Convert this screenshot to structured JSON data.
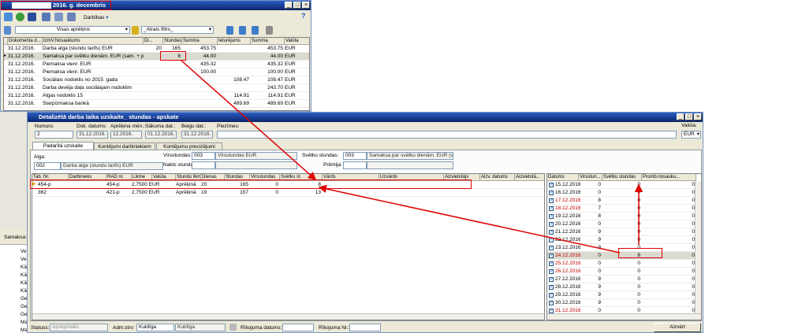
{
  "top_window": {
    "title": "2016. g. decembris",
    "toolbar_darbibas": "Darbības",
    "filter_value": "Visas aprēķins",
    "quick_filter": "_Ātrais filtrs_",
    "columns": [
      "Dokumenta d...",
      "IzmV.Nosaukums",
      "Di...",
      "Stundas",
      "Summa",
      "Ieturējums",
      "Summa",
      "Valūta"
    ],
    "rows": [
      {
        "date": "31.12.2016.",
        "name": "Darba alga (stundu tarifs) EUR",
        "di": "20",
        "hours": "165",
        "sum": "453.75",
        "ded": "",
        "total": "453.75",
        "cur": "EUR"
      },
      {
        "date": "31.12.2016.",
        "name": "Samaksa par svētku dienām. EUR (sam. + piem.)",
        "di": "",
        "hours": "8",
        "sum": "44.00",
        "ded": "",
        "total": "44.00",
        "cur": "EUR"
      },
      {
        "date": "31.12.2016.",
        "name": "Piemaksa vienr. EUR",
        "di": "",
        "hours": "",
        "sum": "435.32",
        "ded": "",
        "total": "435.32",
        "cur": "EUR"
      },
      {
        "date": "31.12.2016.",
        "name": "Piemaksa vienr. EUR",
        "di": "",
        "hours": "",
        "sum": "100.00",
        "ded": "",
        "total": "100.00",
        "cur": "EUR"
      },
      {
        "date": "31.12.2016.",
        "name": "Sociālais nodoklis no 2015. gada",
        "di": "",
        "hours": "",
        "sum": "",
        "ded": "108.47",
        "total": "108.47",
        "cur": "EUR"
      },
      {
        "date": "31.12.2016.",
        "name": "Darba devēja daļa sociālajam nodoklim",
        "di": "",
        "hours": "",
        "sum": "",
        "ded": "",
        "total": "243.70",
        "cur": "EUR"
      },
      {
        "date": "31.12.2016.",
        "name": "Algas nodoklis 15",
        "di": "",
        "hours": "",
        "sum": "",
        "ded": "114.91",
        "total": "114.91",
        "cur": "EUR"
      },
      {
        "date": "31.12.2016.",
        "name": "Starpizmaksa bankā",
        "di": "",
        "hours": "",
        "sum": "",
        "ded": "489.69",
        "total": "489.69",
        "cur": "EUR"
      }
    ]
  },
  "left_strip": {
    "label": "Samaksa:",
    "names": [
      "Veik",
      "Veik",
      "Kārl",
      "Kārl",
      "Kārl",
      "Kārl",
      "Geil",
      "Geil",
      "Geil",
      "Mar",
      "Mar"
    ]
  },
  "main_window": {
    "title": "Detalizētā darba laika uzskaite_ stundas - apskate",
    "labels": {
      "numurs": "Numurs:",
      "dok_datums": "Dok. datums:",
      "aprekina_men": "Aprēķina mēn.:",
      "sakuma_dat": "Sākuma dat.:",
      "beigu_dat": "Beigu dat.:",
      "piezimes": "Piezīmes:",
      "valuta": "Valūta:"
    },
    "values": {
      "numurs": "2",
      "dok_datums": "31.12.2016.",
      "aprekina_men": "12.2016.",
      "sakuma_dat": "01.12.2016.",
      "beigu_dat": "31.12.2016.",
      "piezimes": "",
      "valuta": "EUR"
    },
    "tabs": [
      "Padarītā uzskaite",
      "Kontējumi darbiniekiem",
      "Kontējumu precizējumi"
    ],
    "alga_label": "Alga:",
    "alga_code": "002",
    "alga_name": "Darba alga (stundu tarifs) EUR",
    "virsstundas_label": "Virsstundas:",
    "virsstundas_code": "003",
    "virsstundas_name": "Virsstundas EUR",
    "naktis_label": "Nakts stundas:",
    "svetku_label": "Svētku stundas:",
    "svetku_code": "003",
    "svetku_name": "Samaksa par svētku dienām. EUR (sam",
    "premija_label": "Prēmija:",
    "grid_columns": [
      "Tab. Nr.",
      "Darbinieks",
      "RAD nr.",
      "Likme",
      "Valūta",
      "Stundu likme",
      "Dienas",
      "Stundas",
      "Virsstundas",
      "Svētku st.",
      "Vārds",
      "Uzvārds",
      "Aizvietotājs",
      "Aizv. datums",
      "Aizvietotā..."
    ],
    "grid_rows": [
      {
        "tab": "454-p",
        "rad": "454-p",
        "likme": "2.7500 EUR",
        "stl": "Aprēķinā",
        "dienas": "20",
        "stundas": "165",
        "virs": "0",
        "svet": "8"
      },
      {
        "tab": "362",
        "rad": "421-p",
        "likme": "2.7500 EUR",
        "stl": "Aprēķinā",
        "dienas": "19",
        "stundas": "157",
        "virs": "0",
        "svet": "13"
      }
    ],
    "day_columns": [
      "Datums",
      "Virsstun...",
      "Svētku stundas",
      "Promb.nosauku..."
    ],
    "days": [
      {
        "date": "15.12.2016.",
        "v": "0",
        "s": "0",
        "p": "0",
        "red": false
      },
      {
        "date": "16.12.2016.",
        "v": "0",
        "s": "0",
        "p": "0",
        "red": false
      },
      {
        "date": "17.12.2016.",
        "v": "8",
        "s": "0",
        "p": "0",
        "red": true
      },
      {
        "date": "18.12.2016.",
        "v": "7",
        "s": "0",
        "p": "0",
        "red": true
      },
      {
        "date": "19.12.2016.",
        "v": "8",
        "s": "0",
        "p": "0",
        "red": false
      },
      {
        "date": "20.12.2016.",
        "v": "0",
        "s": "0",
        "p": "0",
        "red": false
      },
      {
        "date": "21.12.2016.",
        "v": "9",
        "s": "0",
        "p": "0",
        "red": false
      },
      {
        "date": "22.12.2016.",
        "v": "9",
        "s": "0",
        "p": "0",
        "red": false
      },
      {
        "date": "23.12.2016.",
        "v": "9",
        "s": "0",
        "p": "0",
        "red": false
      },
      {
        "date": "24.12.2016.",
        "v": "0",
        "s": "8",
        "p": "0",
        "red": true
      },
      {
        "date": "25.12.2016.",
        "v": "0",
        "s": "0",
        "p": "0",
        "red": true
      },
      {
        "date": "26.12.2016.",
        "v": "0",
        "s": "0",
        "p": "0",
        "red": true
      },
      {
        "date": "27.12.2016.",
        "v": "9",
        "s": "0",
        "p": "0",
        "red": false
      },
      {
        "date": "28.12.2016.",
        "v": "9",
        "s": "0",
        "p": "0",
        "red": false
      },
      {
        "date": "29.12.2016.",
        "v": "9",
        "s": "0",
        "p": "0",
        "red": false
      },
      {
        "date": "30.12.2016.",
        "v": "9",
        "s": "0",
        "p": "0",
        "red": false
      },
      {
        "date": "31.12.2016.",
        "v": "0",
        "s": "0",
        "p": "0",
        "red": true
      }
    ],
    "status": {
      "statuss_label": "Statuss:",
      "statuss_value": "Apstiprināts",
      "adm_label": "Adm.strv:",
      "adm_code": "Kuldīga",
      "adm_name": "Kuldīga",
      "rik_datums_label": "Rīkojuma datums:",
      "rik_nr_label": "Rīkojuma Nr.:",
      "close_button": "Aizvērt"
    }
  },
  "colors": {
    "annotation": "#e00000",
    "titlebar": "#0a246a",
    "weekend": "#c00000"
  }
}
